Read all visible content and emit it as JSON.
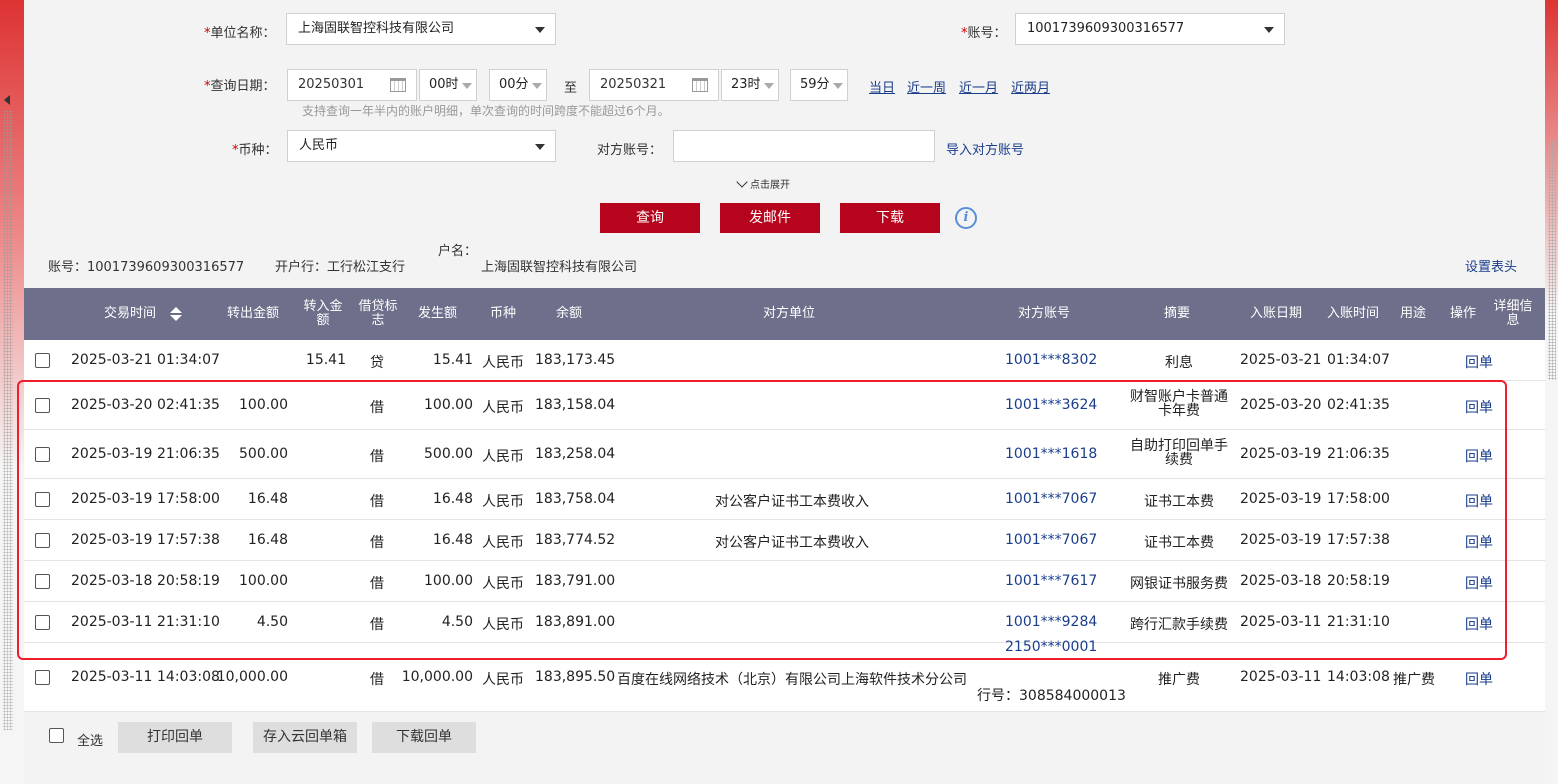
{
  "form": {
    "unit_label": "单位名称：",
    "unit_value": "上海固联智控科技有限公司",
    "account_label": "账号：",
    "account_value": "1001739609300316577",
    "date_label": "查询日期：",
    "start_date": "20250301",
    "start_hour": "00时",
    "start_min": "00分",
    "to_label": "至",
    "end_date": "20250321",
    "end_hour": "23时",
    "end_min": "59分",
    "quick_today": "当日",
    "quick_week": "近一周",
    "quick_month": "近一月",
    "quick_2month": "近两月",
    "date_hint": "支持查询一年半内的账户明细，单次查询的时间跨度不能超过6个月。",
    "currency_label": "币种：",
    "currency_value": "人民币",
    "counter_label": "对方账号：",
    "counter_value": "",
    "import_counter": "导入对方账号",
    "required_mark": "*",
    "expand_label": "点击展开"
  },
  "actions": {
    "query": "查询",
    "send_mail": "发邮件",
    "download": "下载",
    "info_glyph": "i"
  },
  "account_info": {
    "account": "账号：1001739609300316577",
    "bank": "开户行：工行松江支行",
    "holder_label": "户名：",
    "holder_name": "上海固联智控科技有限公司",
    "set_header": "设置表头"
  },
  "table": {
    "headers": {
      "time": "交易时间",
      "out": "转出金额",
      "in_l1": "转入金",
      "in_l2": "额",
      "dc_l1": "借贷标",
      "dc_l2": "志",
      "amount": "发生额",
      "currency": "币种",
      "balance": "余额",
      "counter_unit": "对方单位",
      "counter_acct": "对方账号",
      "summary": "摘要",
      "post_date": "入账日期",
      "post_time": "入账时间",
      "purpose": "用途",
      "op": "操作",
      "detail_l1": "详细信",
      "detail_l2": "息"
    },
    "rows": [
      {
        "date": "2025-03-21",
        "time": "01:34:07",
        "out": "",
        "in": "15.41",
        "dc": "贷",
        "amount": "15.41",
        "currency": "人民币",
        "balance": "183,173.45",
        "unit": "",
        "acct": "1001***8302",
        "acct_bank": "",
        "summary": "利息",
        "summary2": "",
        "post_date": "2025-03-21",
        "post_time": "01:34:07",
        "purpose": "",
        "op": "回单"
      },
      {
        "date": "2025-03-20",
        "time": "02:41:35",
        "out": "100.00",
        "in": "",
        "dc": "借",
        "amount": "100.00",
        "currency": "人民币",
        "balance": "183,158.04",
        "unit": "",
        "acct": "1001***3624",
        "acct_bank": "",
        "summary": "财智账户卡普通",
        "summary2": "卡年费",
        "post_date": "2025-03-20",
        "post_time": "02:41:35",
        "purpose": "",
        "op": "回单"
      },
      {
        "date": "2025-03-19",
        "time": "21:06:35",
        "out": "500.00",
        "in": "",
        "dc": "借",
        "amount": "500.00",
        "currency": "人民币",
        "balance": "183,258.04",
        "unit": "",
        "acct": "1001***1618",
        "acct_bank": "",
        "summary": "自助打印回单手",
        "summary2": "续费",
        "post_date": "2025-03-19",
        "post_time": "21:06:35",
        "purpose": "",
        "op": "回单"
      },
      {
        "date": "2025-03-19",
        "time": "17:58:00",
        "out": "16.48",
        "in": "",
        "dc": "借",
        "amount": "16.48",
        "currency": "人民币",
        "balance": "183,758.04",
        "unit": "对公客户证书工本费收入",
        "acct": "1001***7067",
        "acct_bank": "",
        "summary": "证书工本费",
        "summary2": "",
        "post_date": "2025-03-19",
        "post_time": "17:58:00",
        "purpose": "",
        "op": "回单"
      },
      {
        "date": "2025-03-19",
        "time": "17:57:38",
        "out": "16.48",
        "in": "",
        "dc": "借",
        "amount": "16.48",
        "currency": "人民币",
        "balance": "183,774.52",
        "unit": "对公客户证书工本费收入",
        "acct": "1001***7067",
        "acct_bank": "",
        "summary": "证书工本费",
        "summary2": "",
        "post_date": "2025-03-19",
        "post_time": "17:57:38",
        "purpose": "",
        "op": "回单"
      },
      {
        "date": "2025-03-18",
        "time": "20:58:19",
        "out": "100.00",
        "in": "",
        "dc": "借",
        "amount": "100.00",
        "currency": "人民币",
        "balance": "183,791.00",
        "unit": "",
        "acct": "1001***7617",
        "acct_bank": "",
        "summary": "网银证书服务费",
        "summary2": "",
        "post_date": "2025-03-18",
        "post_time": "20:58:19",
        "purpose": "",
        "op": "回单"
      },
      {
        "date": "2025-03-11",
        "time": "21:31:10",
        "out": "4.50",
        "in": "",
        "dc": "借",
        "amount": "4.50",
        "currency": "人民币",
        "balance": "183,891.00",
        "unit": "",
        "acct": "1001***9284",
        "acct_bank": "",
        "summary": "跨行汇款手续费",
        "summary2": "",
        "post_date": "2025-03-11",
        "post_time": "21:31:10",
        "purpose": "",
        "op": "回单"
      },
      {
        "date": "2025-03-11",
        "time": "14:03:08",
        "out": "10,000.00",
        "in": "",
        "dc": "借",
        "amount": "10,000.00",
        "currency": "人民币",
        "balance": "183,895.50",
        "unit": "百度在线网络技术（北京）有限公司上海软件技术分公司",
        "acct": "2150***0001",
        "acct_bank": "行号：308584000013",
        "summary": "推广费",
        "summary2": "",
        "post_date": "2025-03-11",
        "post_time": "14:03:08",
        "purpose": "推广费",
        "op": "回单"
      }
    ]
  },
  "footer": {
    "select_all": "全选",
    "print": "打印回单",
    "save_cloud": "存入云回单箱",
    "download_receipt": "下载回单"
  },
  "colors": {
    "accent_red": "#b5041c",
    "header_bg": "#6e6f8a",
    "link_blue": "#1a3e8c",
    "highlight_border": "#f21c2a"
  }
}
